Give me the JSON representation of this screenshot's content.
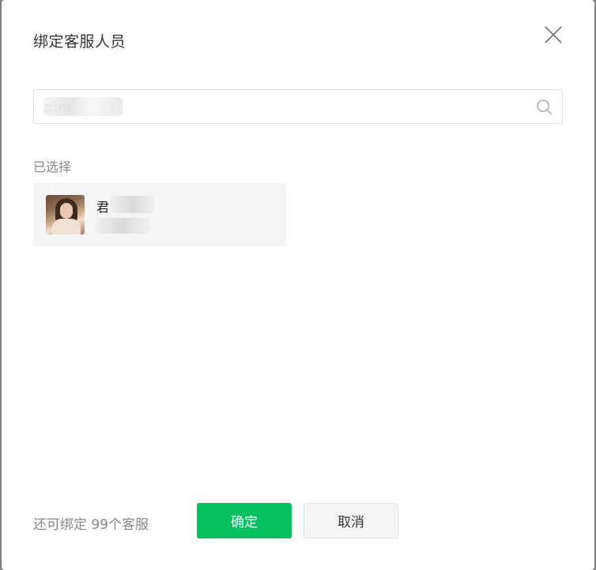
{
  "dialog": {
    "title": "绑定客服人员",
    "close_icon": "close-icon"
  },
  "search": {
    "value": "zqm",
    "placeholder": "",
    "icon": "search-icon"
  },
  "selected": {
    "label": "已选择",
    "item": {
      "name": "君",
      "id": "",
      "avatar": "user-avatar"
    }
  },
  "footer": {
    "remaining_text": "还可绑定 99个客服",
    "confirm_label": "确定",
    "cancel_label": "取消"
  },
  "colors": {
    "primary": "#07c160",
    "text": "#353535",
    "muted": "#888888",
    "card_bg": "#f4f5f7"
  }
}
